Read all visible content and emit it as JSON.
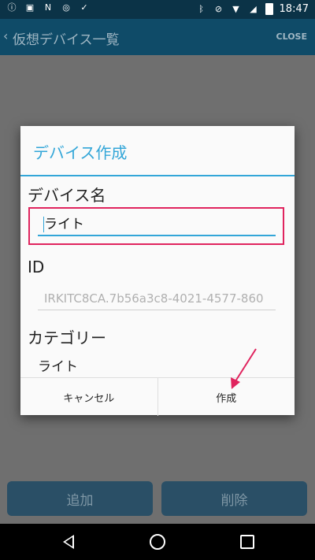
{
  "status_bar": {
    "time": "18:47"
  },
  "app_bar": {
    "title": "仮想デバイス一覧",
    "close_label": "CLOSE"
  },
  "bottom_buttons": {
    "add_label": "追加",
    "delete_label": "削除"
  },
  "dialog": {
    "title": "デバイス作成",
    "name_label": "デバイス名",
    "name_value": "ライト",
    "id_label": "ID",
    "id_value": "IRKITC8CA.7b56a3c8-4021-4577-860",
    "category_label": "カテゴリー",
    "category_value": "ライト",
    "cancel_label": "キャンセル",
    "create_label": "作成"
  },
  "colors": {
    "accent": "#33a6d8",
    "highlight": "#e0245e",
    "app_bar": "#0f4b68"
  }
}
